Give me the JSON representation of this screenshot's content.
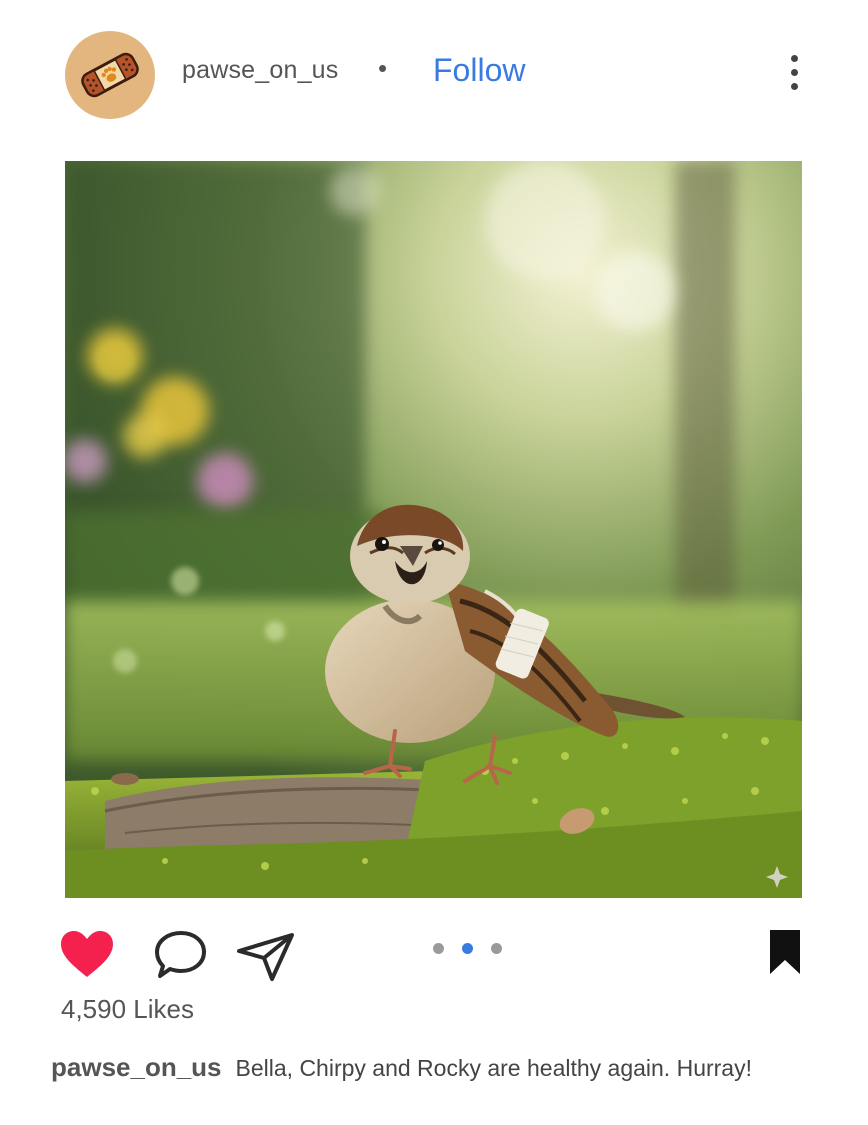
{
  "post": {
    "username": "pawse_on_us",
    "separator": "•",
    "follow_label": "Follow",
    "avatar_icon": "bandage-paw-icon",
    "likes_text": "4,590 Likes",
    "caption_user": "pawse_on_us",
    "caption_text": "Bella, Chirpy and Rocky are healthy again. Hurray!",
    "carousel": {
      "total": 3,
      "active_index": 2
    },
    "liked": true
  },
  "icons": {
    "like": "heart-icon",
    "comment": "comment-icon",
    "share": "paper-plane-icon",
    "save": "bookmark-icon",
    "more": "more-options-icon",
    "sparkle": "sparkle-icon"
  },
  "colors": {
    "accent": "#3a7be0",
    "heart": "#f4204e",
    "avatar_bg": "#e3b67f",
    "pager_active": "#3a7be0",
    "pager_inactive": "#9a9a9a"
  }
}
